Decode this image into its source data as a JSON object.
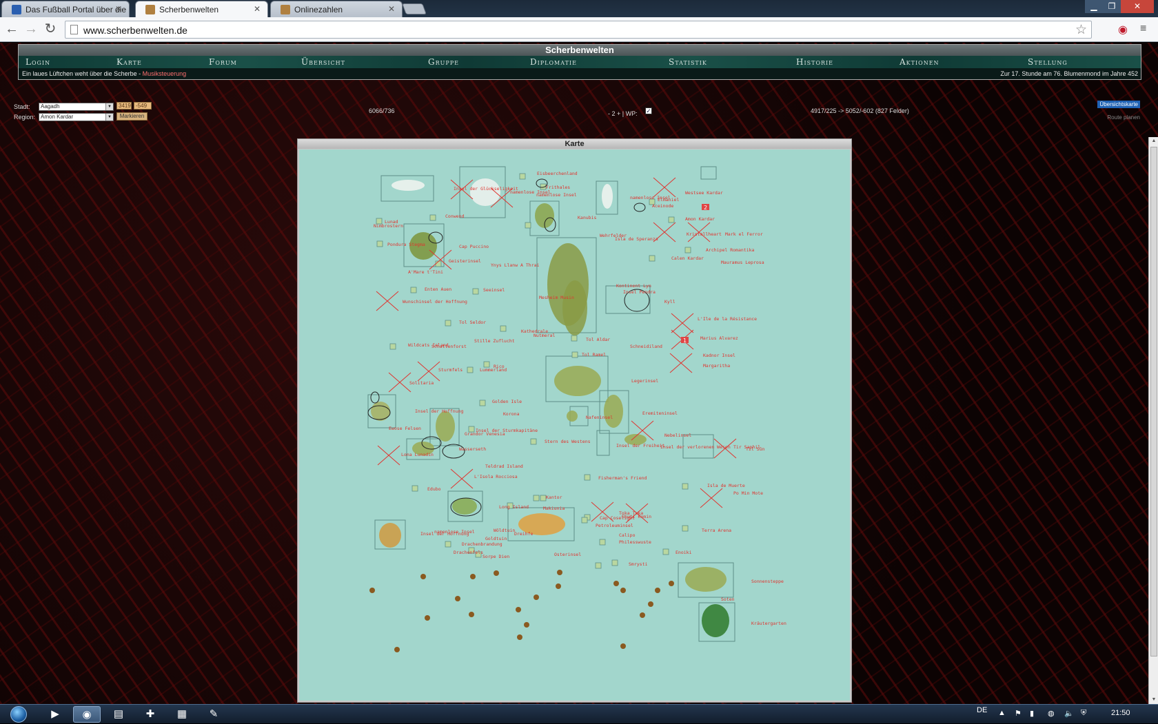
{
  "browser": {
    "tabs": [
      {
        "title": "Das Fußball Portal über die",
        "favicon_color": "#2a5fb0"
      },
      {
        "title": "Scherbenwelten",
        "favicon_color": "#b08040"
      },
      {
        "title": "Onlinezahlen",
        "favicon_color": "#b08040"
      }
    ],
    "url": "www.scherbenwelten.de"
  },
  "site": {
    "title": "Scherbenwelten",
    "nav": [
      "Login",
      "Karte",
      "Forum",
      "Übersicht",
      "Gruppe",
      "Diplomatie",
      "Statistik",
      "Historie",
      "Aktionen",
      "Stellung"
    ],
    "status_text": "Ein laues Lüftchen weht über die Scherbe - ",
    "music_link": "Musiksteuerung",
    "date_text": "Zur 17. Stunde am 76. Blumenmond im Jahre 452"
  },
  "controls": {
    "city_label": "Stadt:",
    "city_value": "Aagadh",
    "coord_x": "3419",
    "coord_y": "-549",
    "region_label": "Region:",
    "region_value": "Amon Kardar",
    "mark_button": "Markieren",
    "position_info": "6066/736",
    "zoom_info": "- 2 + | WP:",
    "range_info": "4917/225 -> 5052/-602 (827 Felder)",
    "overview_button": "Übersichtskarte",
    "route_link": "Route planen"
  },
  "map": {
    "title": "Karte",
    "markers": [
      "2",
      "1"
    ],
    "labels": [
      "Eisbeerchenland",
      "Insel der Glückseligkeit",
      "namenlose Insel",
      "Frithales",
      "namenlose Insel",
      "namenlose Insel",
      "Westsee Kardar",
      "Elmaniel",
      "Aceinode",
      "Amon Kardar",
      "Kristallheart",
      "Mark el Ferror",
      "Archipel Romantika",
      "Calen Kardar",
      "Mauramus Leprosa",
      "Conwend",
      "Lunad",
      "Nimbrostern",
      "Pondura Stegma",
      "Cap Puccino",
      "Kanubis",
      "Wehrfelder",
      "Isla de Speranza",
      "Geisterinsel",
      "Ynys Llanw A Thrai",
      "A'Mare t'Tini",
      "Enten Auen",
      "Seeinsel",
      "Wunschinsel der Hoffnung",
      "Mesheim Musin",
      "Kontinent Lyn",
      "Insel Pendra",
      "Kyll",
      "L'Ile de la Résistance",
      "Tol Seldor",
      "Kathedrale",
      "Nutmeral",
      "Tol Aldar",
      "Schneidiland",
      "Marius Alvarez",
      "Wildcats Island",
      "Schattenforst",
      "Stille Zuflucht",
      "Tol Ramel",
      "Kadnor Insel",
      "Margaritha",
      "Sturmfels",
      "Rico",
      "Lummerland",
      "Solitaria",
      "Legerinsel",
      "Golden Isle",
      "Insel der Hoffnung",
      "Korona",
      "Eremiteninsel",
      "Ewose Felsen",
      "Insel der Sturmkapitäne",
      "Grandor Venesia",
      "Nafeninsel",
      "Nebelinsel",
      "Stern des Westens",
      "Insel der Freiheit",
      "Insel der verlorenen Wesen",
      "Tir Saphil",
      "Til Sûn",
      "Lona Lunadin",
      "Wasserseth",
      "Teldrad Island",
      "L'Isola Rocciosa",
      "Fisherman's Friend",
      "Isla de Muerte",
      "Edubo",
      "Kantor",
      "Po Min Mote",
      "Long Island",
      "Makiunia",
      "Tokа Tuka",
      "Cap Coselight",
      "Shuti Komin",
      "Petroleuminsel",
      "Terra Arena",
      "namenlose Insel",
      "Insel der Hoffnung",
      "Wöldtuin",
      "Goldtuin",
      "Dreihfe",
      "Calipo",
      "Philesswuste",
      "Drachenbrandung",
      "Drachenfels",
      "Sorpe Dien",
      "Osterinsel",
      "Enoiki",
      "Smrysti",
      "Sonnensteppe",
      "Soten",
      "Kräutergarten"
    ]
  },
  "taskbar": {
    "language": "DE",
    "clock": "21:50"
  },
  "colors": {
    "map_water": "#a2d6cc",
    "label_red": "#e0342f",
    "nav_bg": "#1a5048",
    "marker_red": "#e04545"
  }
}
